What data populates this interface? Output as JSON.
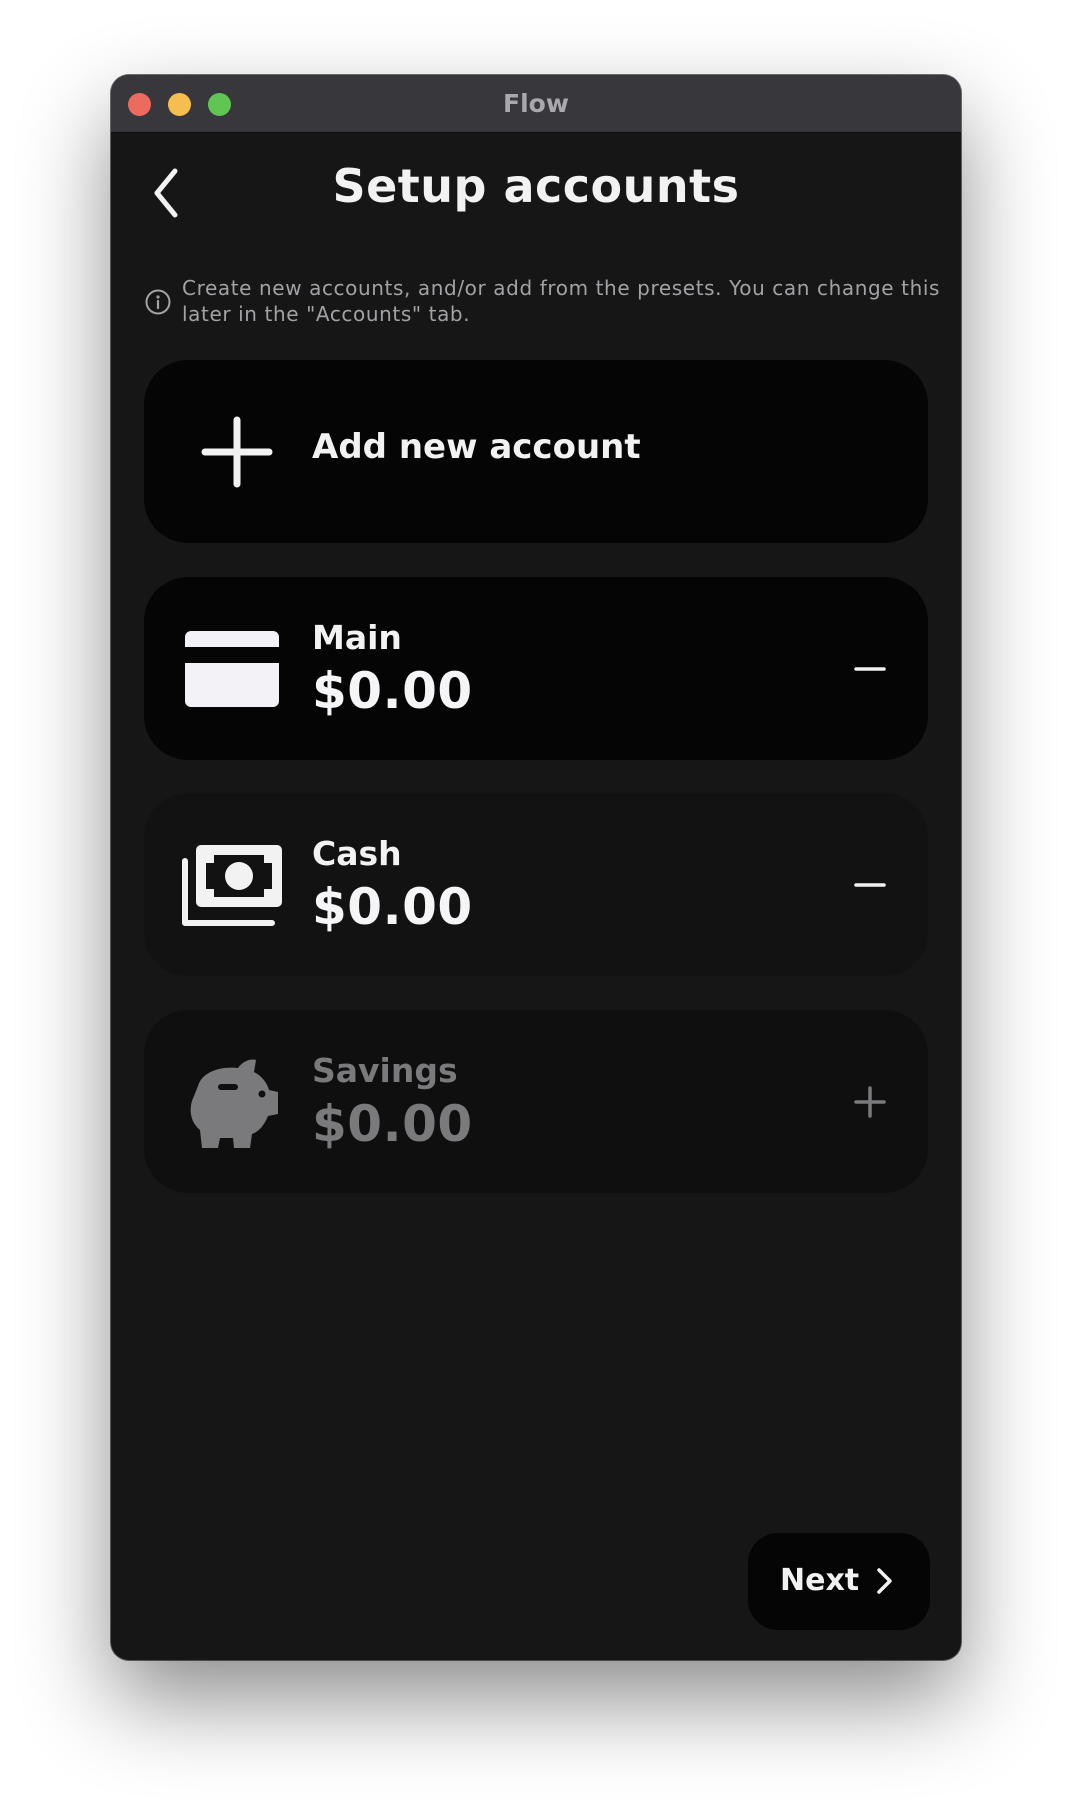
{
  "window": {
    "title": "Flow"
  },
  "header": {
    "title": "Setup accounts",
    "back_icon": "chevron-left-icon"
  },
  "info": {
    "icon": "info-icon",
    "text": "Create new accounts, and/or add from the presets. You can change this later in the \"Accounts\" tab."
  },
  "add_account": {
    "icon": "plus-icon",
    "label": "Add new account"
  },
  "accounts": [
    {
      "icon": "credit-card-icon",
      "name": "Main",
      "balance": "$0.00",
      "action": "minus-icon",
      "added": true
    },
    {
      "icon": "cash-icon",
      "name": "Cash",
      "balance": "$0.00",
      "action": "minus-icon",
      "added": true
    },
    {
      "icon": "piggy-bank-icon",
      "name": "Savings",
      "balance": "$0.00",
      "action": "plus-icon",
      "added": false
    }
  ],
  "footer": {
    "next_label": "Next",
    "next_icon": "chevron-right-icon"
  },
  "colors": {
    "background": "#161616",
    "card": "#050505",
    "text": "#f2f2f2",
    "muted_text": "#7a7a7d",
    "titlebar": "#38373b"
  }
}
